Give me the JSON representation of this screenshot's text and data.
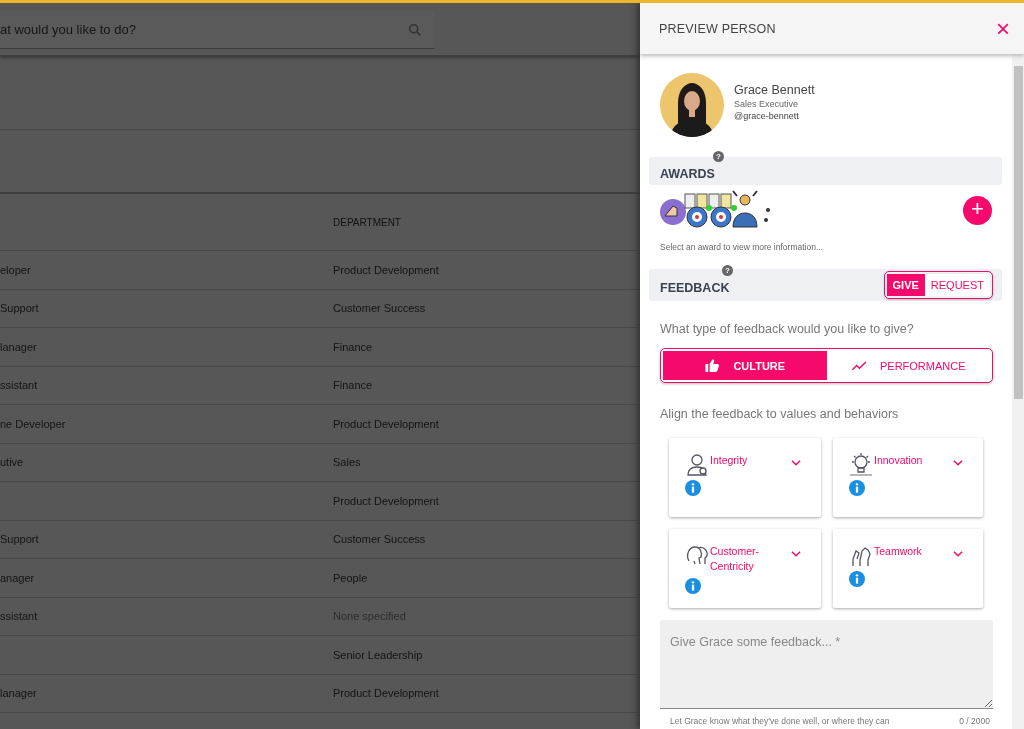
{
  "search": {
    "placeholder": "at would you like to do?"
  },
  "table": {
    "columns": [
      {
        "label": "DEPARTMENT"
      }
    ],
    "rows": [
      {
        "role": "eloper",
        "department": "Product Development",
        "muted": false
      },
      {
        "role": "Support",
        "department": "Customer Success",
        "muted": false
      },
      {
        "role": "lanager",
        "department": "Finance",
        "muted": false
      },
      {
        "role": "ssistant",
        "department": "Finance",
        "muted": false
      },
      {
        "role": "ne Developer",
        "department": "Product Development",
        "muted": false
      },
      {
        "role": "utive",
        "department": "Sales",
        "muted": false
      },
      {
        "department": "Product Development",
        "muted": false
      },
      {
        "role": "Support",
        "department": "Customer Success",
        "muted": false
      },
      {
        "role": "anager",
        "department": "People",
        "muted": false
      },
      {
        "role": "ssistant",
        "department": "None specified",
        "muted": true
      },
      {
        "department": "Senior Leadership",
        "muted": false
      },
      {
        "role": "lanager",
        "department": "Product Development",
        "muted": false
      }
    ]
  },
  "panel": {
    "title": "PREVIEW PERSON",
    "close": "×",
    "person": {
      "name": "Grace Bennett",
      "job_title": "Sales Executive",
      "handle": "@grace-bennett"
    },
    "awards": {
      "heading": "AWARDS",
      "help": "?",
      "add": "+",
      "caption": "Select an award to view more information..."
    },
    "feedback": {
      "heading": "FEEDBACK",
      "help": "?",
      "modes": [
        {
          "label": "GIVE",
          "selected": true
        },
        {
          "label": "REQUEST",
          "selected": false
        }
      ],
      "question": "What type of feedback would you like to give?",
      "types": [
        {
          "label": "CULTURE",
          "kind": "thumb",
          "selected": true
        },
        {
          "label": "PERFORMANCE",
          "kind": "trend",
          "selected": false
        }
      ],
      "align_text": "Align the feedback to values and behaviors",
      "values": [
        {
          "label": "Integrity",
          "kind": "person"
        },
        {
          "label": "Innovation",
          "kind": "bulb"
        },
        {
          "label": "Customer-Centricity",
          "kind": "heads"
        },
        {
          "label": "Teamwork",
          "kind": "hands"
        }
      ],
      "textarea": {
        "placeholder": "Give Grace some feedback... *",
        "hint": "Let Grace know what they've done well, or where they can",
        "counter": "0 / 2000"
      }
    }
  }
}
